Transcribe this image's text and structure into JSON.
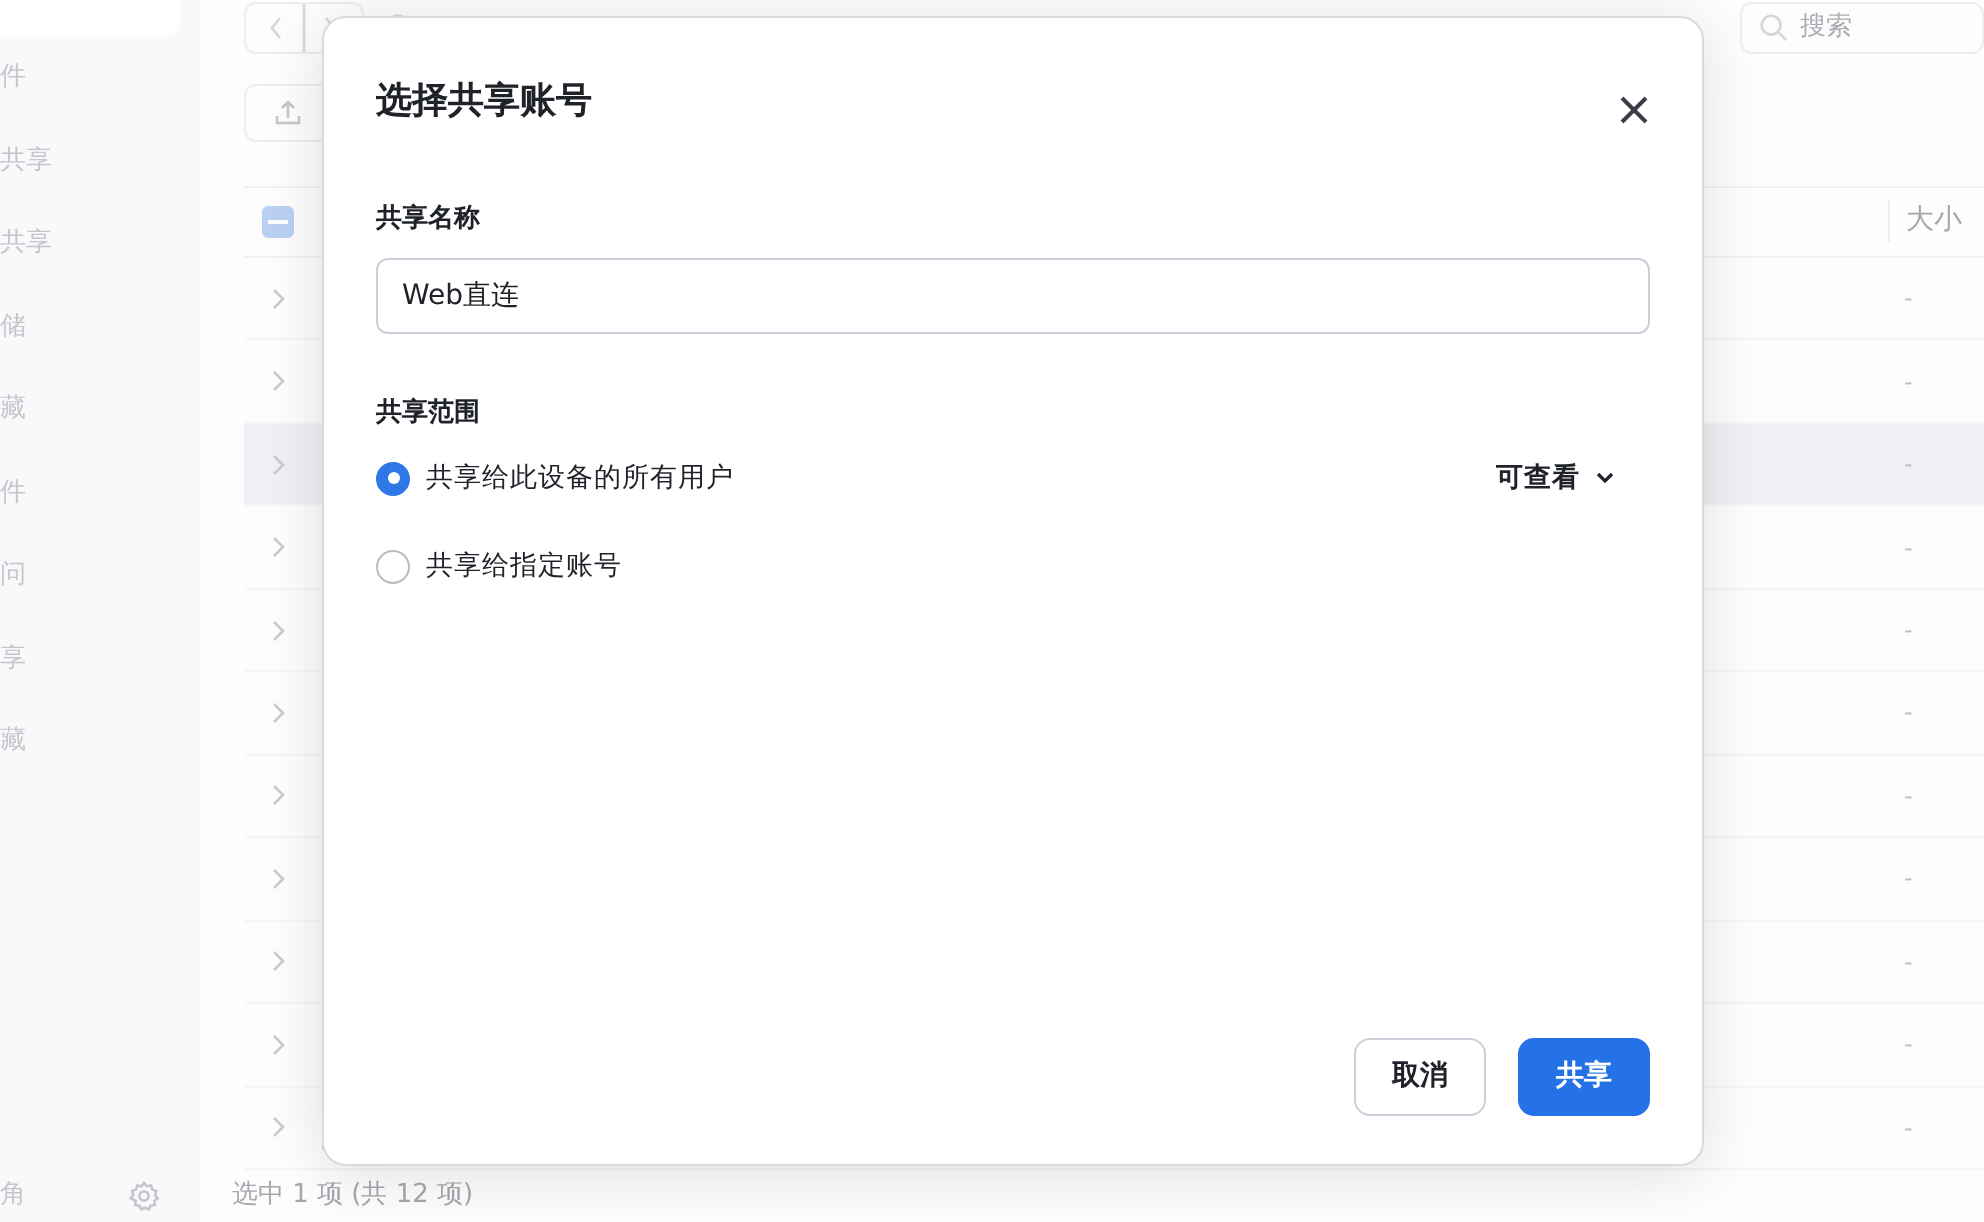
{
  "sidebar": {
    "items": [
      {
        "label": "件"
      },
      {
        "label": "共享"
      },
      {
        "label": "共享"
      },
      {
        "label": "储"
      },
      {
        "label": "藏"
      },
      {
        "label": "件"
      },
      {
        "label": "问"
      },
      {
        "label": "享"
      },
      {
        "label": "藏"
      }
    ],
    "footer_label": "角"
  },
  "toolbar": {
    "search_placeholder": "搜索"
  },
  "table": {
    "select_all_partial": true,
    "columns": [
      {
        "label": "大小"
      }
    ],
    "rows": [
      {
        "size": "-",
        "highlighted": false
      },
      {
        "size": "-",
        "highlighted": false
      },
      {
        "size": "-",
        "highlighted": true
      },
      {
        "size": "-",
        "highlighted": false
      },
      {
        "size": "-",
        "highlighted": false
      },
      {
        "size": "-",
        "highlighted": false
      },
      {
        "size": "-",
        "highlighted": false
      },
      {
        "size": "-",
        "highlighted": false
      },
      {
        "size": "-",
        "highlighted": false
      },
      {
        "size": "-",
        "highlighted": false
      },
      {
        "size": "-",
        "highlighted": false
      }
    ]
  },
  "status_bar": "选中 1 项 (共 12 项)",
  "dialog": {
    "title": "选择共享账号",
    "name_label": "共享名称",
    "name_value": "Web直连",
    "scope_label": "共享范围",
    "options": [
      {
        "label": "共享给此设备的所有用户",
        "selected": true,
        "permission": "可查看"
      },
      {
        "label": "共享给指定账号",
        "selected": false
      }
    ],
    "buttons": [
      {
        "label": "取消",
        "kind": "secondary"
      },
      {
        "label": "共享",
        "kind": "primary"
      }
    ]
  }
}
